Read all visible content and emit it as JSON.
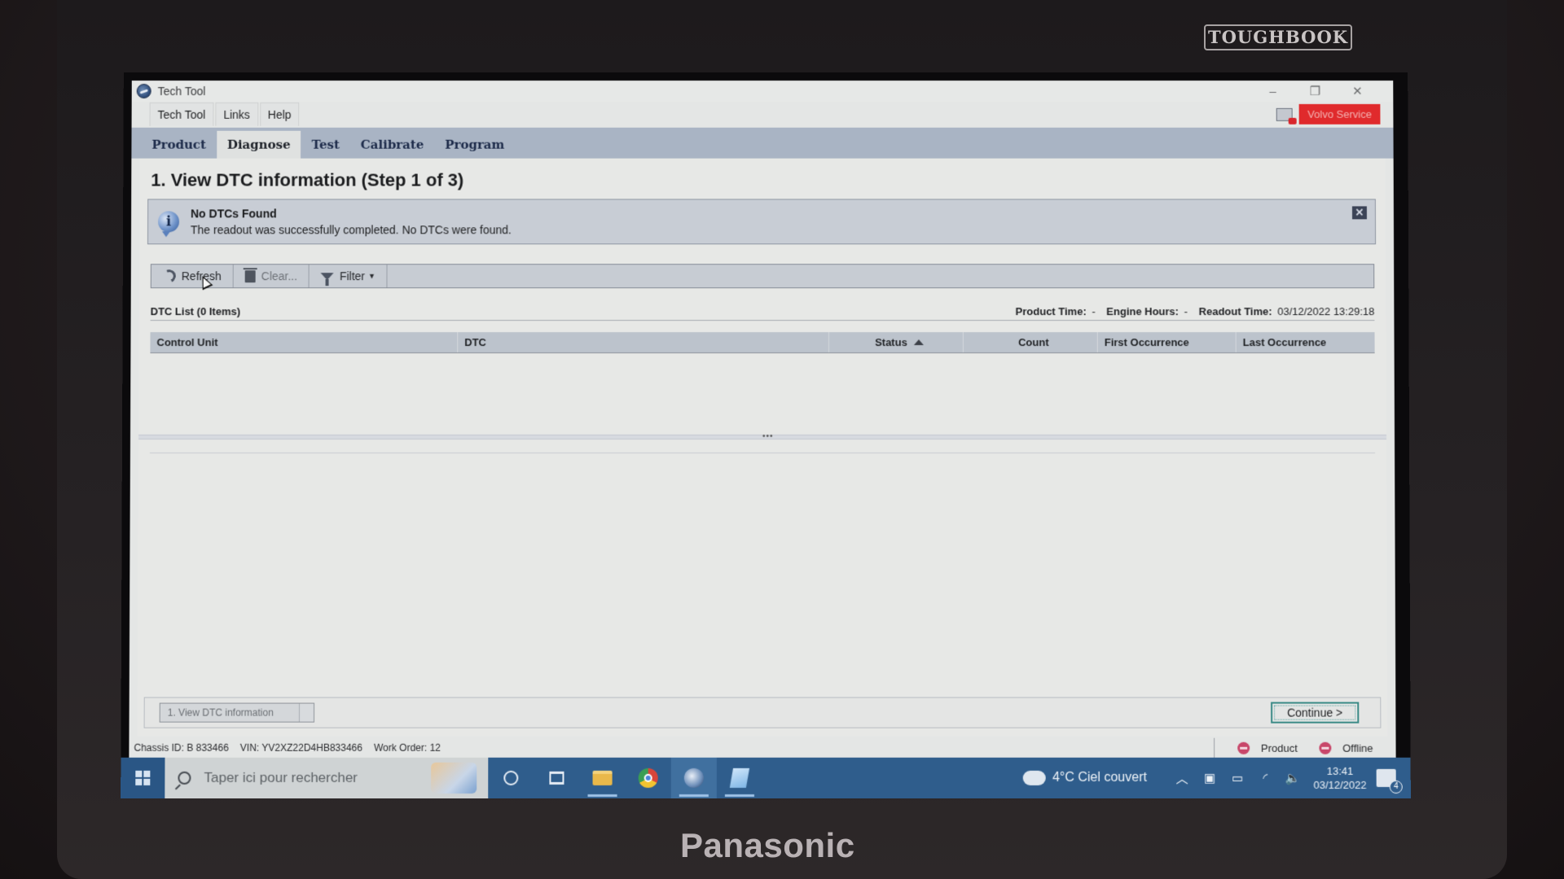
{
  "device": {
    "top_brand": "TOUGHBOOK",
    "bottom_brand": "Panasonic"
  },
  "window": {
    "title": "Tech Tool",
    "controls": {
      "minimize": "–",
      "restore": "❐",
      "close": "✕"
    }
  },
  "menubar": {
    "items": [
      "Tech Tool",
      "Links",
      "Help"
    ],
    "brand_button": "Volvo Service",
    "brand_color": "#e02a2c"
  },
  "tabs": {
    "items": [
      "Product",
      "Diagnose",
      "Test",
      "Calibrate",
      "Program"
    ],
    "active": "Diagnose"
  },
  "page": {
    "heading": "1. View DTC information (Step 1 of 3)"
  },
  "banner": {
    "icon": "info-icon",
    "title": "No DTCs Found",
    "message": "The readout was successfully completed. No DTCs were found.",
    "close": "✕"
  },
  "toolbar": {
    "refresh": "Refresh",
    "clear": "Clear...",
    "filter": "Filter"
  },
  "dtc_list": {
    "title": "DTC List (0 Items)",
    "product_time_label": "Product Time:",
    "product_time_value": "-",
    "engine_hours_label": "Engine Hours:",
    "engine_hours_value": "-",
    "readout_time_label": "Readout Time:",
    "readout_time_value": "03/12/2022 13:29:18",
    "columns": [
      "Control Unit",
      "DTC",
      "Status",
      "Count",
      "First Occurrence",
      "Last Occurrence"
    ],
    "sort_column": "Status",
    "sort_direction": "ascending",
    "rows": []
  },
  "footer_panel": {
    "step_select": "1. View DTC information",
    "continue": "Continue >"
  },
  "statusbar": {
    "chassis": "Chassis ID: B 833466",
    "vin": "VIN: YV2XZ22D4HB833466",
    "work_order": "Work Order: 12",
    "product_status": "Product",
    "connection_status": "Offline",
    "status_color": "#c8476a"
  },
  "taskbar": {
    "search_placeholder": "Taper ici pour rechercher",
    "weather": "4°C  Ciel couvert",
    "time": "13:41",
    "date": "03/12/2022",
    "notifications": "4"
  }
}
